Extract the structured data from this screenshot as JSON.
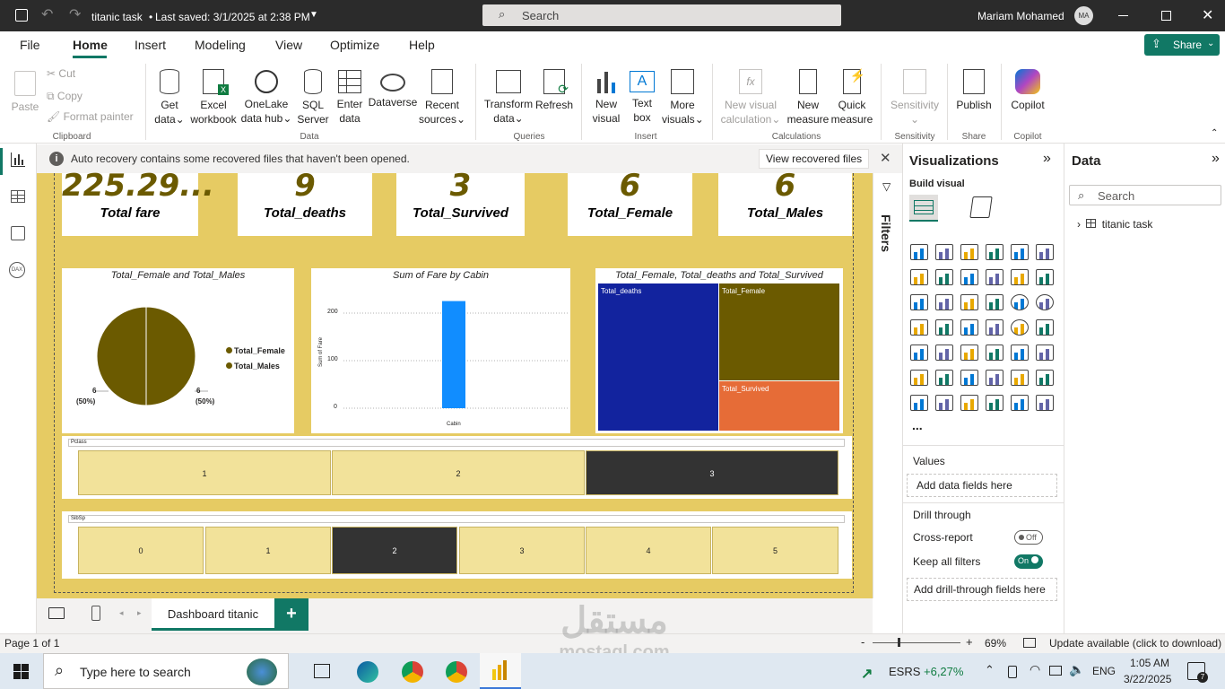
{
  "titlebar": {
    "file_title": "titanic task",
    "saved": "Last saved: 3/1/2025 at 2:38 PM",
    "search": "Search",
    "user": "Mariam Mohamed",
    "initials": "MA"
  },
  "menu": [
    "File",
    "Home",
    "Insert",
    "Modeling",
    "View",
    "Optimize",
    "Help"
  ],
  "share": "Share",
  "ribbon": {
    "clipboard": {
      "paste": "Paste",
      "cut": "Cut",
      "copy": "Copy",
      "format": "Format painter",
      "group": "Clipboard"
    },
    "data": {
      "get1": "Get",
      "get2": "data",
      "excel1": "Excel",
      "excel2": "workbook",
      "onelake1": "OneLake",
      "onelake2": "data hub",
      "sql1": "SQL",
      "sql2": "Server",
      "enter1": "Enter",
      "enter2": "data",
      "dataverse": "Dataverse",
      "recent1": "Recent",
      "recent2": "sources",
      "group": "Data"
    },
    "queries": {
      "transform1": "Transform",
      "transform2": "data",
      "refresh": "Refresh",
      "group": "Queries"
    },
    "insert": {
      "newvisual1": "New",
      "newvisual2": "visual",
      "textbox1": "Text",
      "textbox2": "box",
      "more1": "More",
      "more2": "visuals",
      "group": "Insert"
    },
    "calc": {
      "nvc1": "New visual",
      "nvc2": "calculation",
      "nm1": "New",
      "nm2": "measure",
      "qm1": "Quick",
      "qm2": "measure",
      "group": "Calculations"
    },
    "sens": {
      "label": "Sensitivity",
      "group": "Sensitivity"
    },
    "share": {
      "publish": "Publish",
      "group": "Share"
    },
    "copilot": {
      "label": "Copilot",
      "group": "Copilot"
    }
  },
  "recovery": {
    "message": "Auto recovery contains some recovered files that haven't been opened.",
    "button": "View recovered files"
  },
  "filters": "Filters",
  "cards": [
    {
      "value": "225.29...",
      "label": "Total fare"
    },
    {
      "value": "9",
      "label": "Total_deaths"
    },
    {
      "value": "3",
      "label": "Total_Survived"
    },
    {
      "value": "6",
      "label": "Total_Female"
    },
    {
      "value": "6",
      "label": "Total_Males"
    }
  ],
  "pie": {
    "title": "Total_Female and Total_Males",
    "legend": [
      "Total_Female",
      "Total_Males"
    ],
    "left_value": "6",
    "left_pct": "(50%)",
    "right_value": "6",
    "right_pct": "(50%)",
    "colors": [
      "#6b5a00",
      "#6b5a00"
    ]
  },
  "chart_data": [
    {
      "type": "pie",
      "title": "Total_Female and Total_Males",
      "categories": [
        "Total_Female",
        "Total_Males"
      ],
      "values": [
        6,
        6
      ]
    },
    {
      "type": "bar",
      "title": "Sum of Fare by Cabin",
      "xlabel": "Cabin",
      "ylabel": "Sum of Fare",
      "categories": [
        ""
      ],
      "values": [
        225.29
      ],
      "ylim": [
        0,
        240
      ],
      "yticks": [
        0,
        100,
        200
      ]
    },
    {
      "type": "treemap",
      "title": "Total_Female, Total_deaths and Total_Survived",
      "categories": [
        "Total_deaths",
        "Total_Female",
        "Total_Survived"
      ],
      "values": [
        9,
        6,
        3
      ]
    }
  ],
  "bar": {
    "title": "Sum of Fare by Cabin",
    "xlabel": "Cabin",
    "ylabel": "Sum of Fare",
    "ticks": [
      "200",
      "100",
      "0"
    ]
  },
  "treemap": {
    "title": "Total_Female, Total_deaths and Total_Survived",
    "labels": [
      "Total_deaths",
      "Total_Female",
      "Total_Survived"
    ],
    "colors": [
      "#12239e",
      "#6b5a00",
      "#e66c37"
    ]
  },
  "slicer_pclass": {
    "title": "Pclass",
    "items": [
      "1",
      "2",
      "3"
    ],
    "selected": "3"
  },
  "slicer_sibsp": {
    "title": "SibSp",
    "items": [
      "0",
      "1",
      "2",
      "3",
      "4",
      "5"
    ],
    "selected": "2"
  },
  "page_tab": "Dashboard titanic",
  "viz": {
    "title": "Visualizations",
    "build": "Build visual",
    "values": "Values",
    "add_data": "Add data fields here",
    "drill": "Drill through",
    "cross": "Cross-report",
    "cross_state": "Off",
    "keep": "Keep all filters",
    "keep_state": "On",
    "add_drill": "Add drill-through fields here",
    "more": "..."
  },
  "data_pane": {
    "title": "Data",
    "search": "Search",
    "table": "titanic task"
  },
  "status": {
    "page": "Page 1 of 1",
    "zoom": "69%",
    "update": "Update available (click to download)"
  },
  "taskbar": {
    "search": "Type here to search",
    "stock": "ESRS",
    "stock_change": "+6,27%",
    "lang": "ENG",
    "time": "1:05 AM",
    "date": "3/22/2025",
    "notif": "7"
  },
  "watermark": {
    "arabic": "مستقل",
    "latin": "mostaql.com"
  }
}
